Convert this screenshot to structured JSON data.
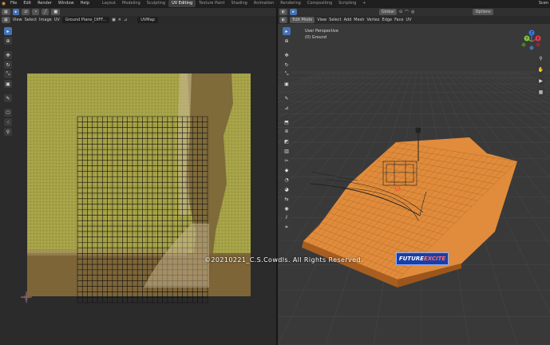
{
  "topbar": {
    "menu": [
      "File",
      "Edit",
      "Render",
      "Window",
      "Help"
    ],
    "workspaces": [
      "Layout",
      "Modeling",
      "Sculpting",
      "UV Editing",
      "Texture Paint",
      "Shading",
      "Animation",
      "Rendering",
      "Compositing",
      "Scripting"
    ],
    "active_workspace": "UV Editing",
    "add_tab": "+",
    "scene": "Scen"
  },
  "uv_editor": {
    "menus": [
      "View",
      "Select",
      "Image",
      "UV"
    ],
    "image_name": "Ground Plane_DIFF...",
    "uvmap": "UVMap"
  },
  "viewport": {
    "mode": "Edit Mode",
    "menus": [
      "View",
      "Select",
      "Add",
      "Mesh",
      "Vertex",
      "Edge",
      "Face",
      "UV"
    ],
    "transform": "Global",
    "options": "Options",
    "title": "User Perspective",
    "object": "(0) Ground",
    "gizmo": {
      "x": "X",
      "y": "Y",
      "z": "Z"
    }
  },
  "overlay": {
    "copyright": "©20210221_C.S.Cowdls. All Rights Reserved.",
    "logo_main": "FUTURE ",
    "logo_accent": "EXCITE"
  },
  "colors": {
    "accent": "#4772b3",
    "mesh_orange": "#e08c3c",
    "texture_green": "#a6a142",
    "texture_brown": "#7a5f37"
  }
}
